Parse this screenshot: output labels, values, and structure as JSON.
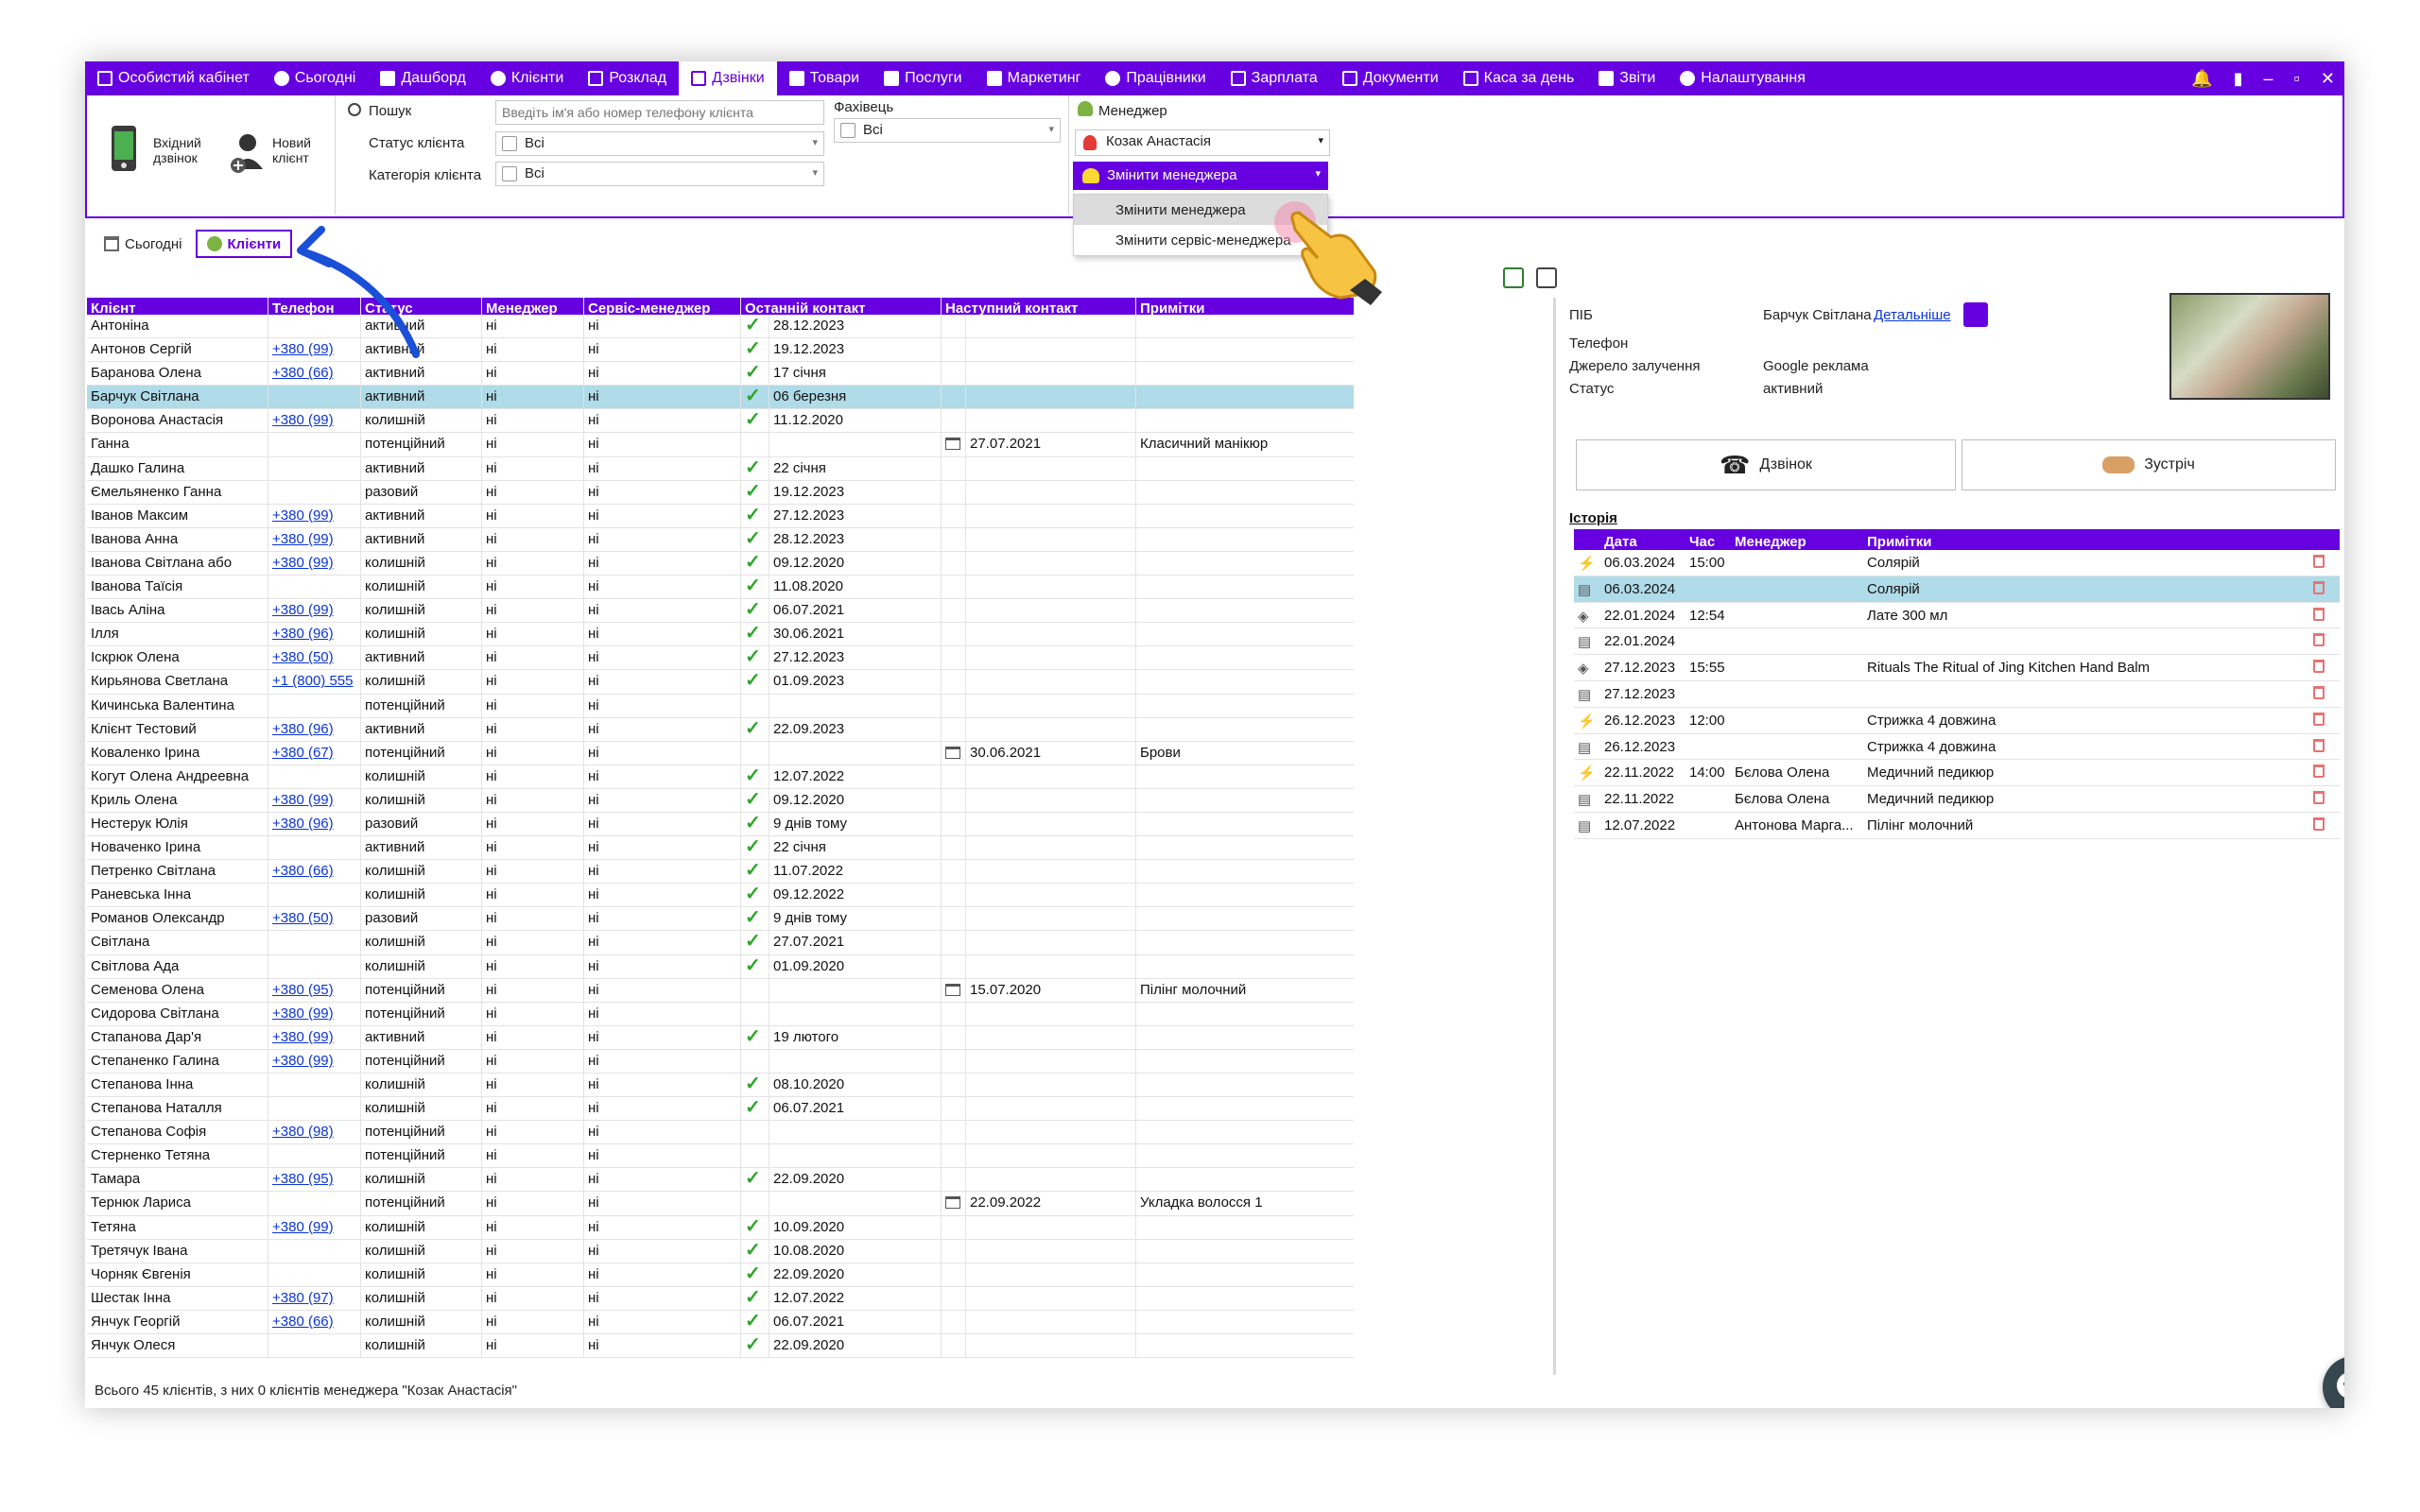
{
  "nav": {
    "items": [
      {
        "label": "Особистий кабінет",
        "icon": "cabinet-icon",
        "active": false
      },
      {
        "label": "Сьогодні",
        "icon": "today-icon",
        "active": false
      },
      {
        "label": "Дашборд",
        "icon": "dashboard-icon",
        "active": false
      },
      {
        "label": "Клієнти",
        "icon": "clients-icon",
        "active": false
      },
      {
        "label": "Розклад",
        "icon": "schedule-icon",
        "active": false
      },
      {
        "label": "Дзвінки",
        "icon": "calls-icon",
        "active": true
      },
      {
        "label": "Товари",
        "icon": "products-icon",
        "active": false
      },
      {
        "label": "Послуги",
        "icon": "services-icon",
        "active": false
      },
      {
        "label": "Маркетинг",
        "icon": "marketing-icon",
        "active": false
      },
      {
        "label": "Працівники",
        "icon": "employees-icon",
        "active": false
      },
      {
        "label": "Зарплата",
        "icon": "salary-icon",
        "active": false
      },
      {
        "label": "Документи",
        "icon": "documents-icon",
        "active": false
      },
      {
        "label": "Каса за день",
        "icon": "cash-icon",
        "active": false
      },
      {
        "label": "Звіти",
        "icon": "reports-icon",
        "active": false
      },
      {
        "label": "Налаштування",
        "icon": "settings-icon",
        "active": false
      }
    ]
  },
  "ribbon": {
    "incoming_call": "Вхідний дзвінок",
    "new_client": "Новий клієнт",
    "search_label": "Пошук",
    "search_placeholder": "Введіть ім'я або номер телефону клієнта",
    "status_label": "Статус клієнта",
    "status_value": "Всі",
    "category_label": "Категорія клієнта",
    "category_value": "Всі",
    "specialist_label": "Фахівець",
    "specialist_value": "Всі",
    "manager_label": "Менеджер",
    "manager_value": "Козак Анастасія",
    "change_manager_button": "Змінити менеджера",
    "menu_items": [
      "Змінити менеджера",
      "Змінити сервіс-менеджера"
    ]
  },
  "subtabs": [
    {
      "label": "Сьогодні",
      "active": false
    },
    {
      "label": "Клієнти",
      "active": true
    }
  ],
  "grid": {
    "columns": [
      "Клієнт",
      "Телефон",
      "Статус",
      "Менеджер",
      "Сервіс-менеджер",
      "Останній контакт",
      "Наступний контакт",
      "Примітки"
    ],
    "rows": [
      {
        "name": "Антоніна",
        "phone": "",
        "status": "активний",
        "mgr": "ні",
        "smgr": "ні",
        "check": true,
        "last": "28.12.2023",
        "cal": false,
        "next": "",
        "notes": ""
      },
      {
        "name": "Антонов Сергій",
        "phone": "+380 (99)",
        "status": "активний",
        "mgr": "ні",
        "smgr": "ні",
        "check": true,
        "last": "19.12.2023",
        "cal": false,
        "next": "",
        "notes": ""
      },
      {
        "name": "Баранова Олена",
        "phone": "+380 (66)",
        "status": "активний",
        "mgr": "ні",
        "smgr": "ні",
        "check": true,
        "last": "17 січня",
        "cal": false,
        "next": "",
        "notes": ""
      },
      {
        "name": "Барчук Світлана",
        "phone": "",
        "status": "активний",
        "mgr": "ні",
        "smgr": "ні",
        "check": true,
        "last": "06 березня",
        "cal": false,
        "next": "",
        "notes": "",
        "selected": true
      },
      {
        "name": "Воронова Анастасія",
        "phone": "+380 (99)",
        "status": "колишній",
        "mgr": "ні",
        "smgr": "ні",
        "check": true,
        "last": "11.12.2020",
        "cal": false,
        "next": "",
        "notes": ""
      },
      {
        "name": "Ганна",
        "phone": "",
        "status": "потенційний",
        "mgr": "ні",
        "smgr": "ні",
        "check": false,
        "last": "",
        "cal": true,
        "next": "27.07.2021",
        "notes": "Класичний манікюр"
      },
      {
        "name": "Дашко Галина",
        "phone": "",
        "status": "активний",
        "mgr": "ні",
        "smgr": "ні",
        "check": true,
        "last": "22 січня",
        "cal": false,
        "next": "",
        "notes": ""
      },
      {
        "name": "Ємельяненко Ганна",
        "phone": "",
        "status": "разовий",
        "mgr": "ні",
        "smgr": "ні",
        "check": true,
        "last": "19.12.2023",
        "cal": false,
        "next": "",
        "notes": ""
      },
      {
        "name": "Іванов Максим",
        "phone": "+380 (99)",
        "status": "активний",
        "mgr": "ні",
        "smgr": "ні",
        "check": true,
        "last": "27.12.2023",
        "cal": false,
        "next": "",
        "notes": ""
      },
      {
        "name": "Іванова Анна",
        "phone": "+380 (99)",
        "status": "активний",
        "mgr": "ні",
        "smgr": "ні",
        "check": true,
        "last": "28.12.2023",
        "cal": false,
        "next": "",
        "notes": ""
      },
      {
        "name": "Іванова Світлана або",
        "phone": "+380 (99)",
        "status": "колишній",
        "mgr": "ні",
        "smgr": "ні",
        "check": true,
        "last": "09.12.2020",
        "cal": false,
        "next": "",
        "notes": ""
      },
      {
        "name": "Іванова Таїсія",
        "phone": "",
        "status": "колишній",
        "mgr": "ні",
        "smgr": "ні",
        "check": true,
        "last": "11.08.2020",
        "cal": false,
        "next": "",
        "notes": ""
      },
      {
        "name": "Івась Аліна",
        "phone": "+380 (99)",
        "status": "колишній",
        "mgr": "ні",
        "smgr": "ні",
        "check": true,
        "last": "06.07.2021",
        "cal": false,
        "next": "",
        "notes": ""
      },
      {
        "name": "Ілля",
        "phone": "+380 (96)",
        "status": "колишній",
        "mgr": "ні",
        "smgr": "ні",
        "check": true,
        "last": "30.06.2021",
        "cal": false,
        "next": "",
        "notes": ""
      },
      {
        "name": "Іскрюк Олена",
        "phone": "+380 (50)",
        "status": "активний",
        "mgr": "ні",
        "smgr": "ні",
        "check": true,
        "last": "27.12.2023",
        "cal": false,
        "next": "",
        "notes": ""
      },
      {
        "name": "Кирьянова Светлана",
        "phone": "+1 (800) 555",
        "status": "колишній",
        "mgr": "ні",
        "smgr": "ні",
        "check": true,
        "last": "01.09.2023",
        "cal": false,
        "next": "",
        "notes": ""
      },
      {
        "name": "Кичинська Валентина",
        "phone": "",
        "status": "потенційний",
        "mgr": "ні",
        "smgr": "ні",
        "check": false,
        "last": "",
        "cal": false,
        "next": "",
        "notes": ""
      },
      {
        "name": "Клієнт Тестовий",
        "phone": "+380 (96)",
        "status": "активний",
        "mgr": "ні",
        "smgr": "ні",
        "check": true,
        "last": "22.09.2023",
        "cal": false,
        "next": "",
        "notes": ""
      },
      {
        "name": "Коваленко Ірина",
        "phone": "+380 (67)",
        "status": "потенційний",
        "mgr": "ні",
        "smgr": "ні",
        "check": false,
        "last": "",
        "cal": true,
        "next": "30.06.2021",
        "notes": "Брови"
      },
      {
        "name": "Когут Олена Андреевна",
        "phone": "",
        "status": "колишній",
        "mgr": "ні",
        "smgr": "ні",
        "check": true,
        "last": "12.07.2022",
        "cal": false,
        "next": "",
        "notes": ""
      },
      {
        "name": "Криль Олена",
        "phone": "+380 (99)",
        "status": "колишній",
        "mgr": "ні",
        "smgr": "ні",
        "check": true,
        "last": "09.12.2020",
        "cal": false,
        "next": "",
        "notes": ""
      },
      {
        "name": "Нестерук Юлія",
        "phone": "+380 (96)",
        "status": "разовий",
        "mgr": "ні",
        "smgr": "ні",
        "check": true,
        "last": "9 днів тому",
        "cal": false,
        "next": "",
        "notes": ""
      },
      {
        "name": "Новаченко Ірина",
        "phone": "",
        "status": "активний",
        "mgr": "ні",
        "smgr": "ні",
        "check": true,
        "last": "22 січня",
        "cal": false,
        "next": "",
        "notes": ""
      },
      {
        "name": "Петренко Світлана",
        "phone": "+380 (66)",
        "status": "колишній",
        "mgr": "ні",
        "smgr": "ні",
        "check": true,
        "last": "11.07.2022",
        "cal": false,
        "next": "",
        "notes": ""
      },
      {
        "name": "Раневська Інна",
        "phone": "",
        "status": "колишній",
        "mgr": "ні",
        "smgr": "ні",
        "check": true,
        "last": "09.12.2022",
        "cal": false,
        "next": "",
        "notes": ""
      },
      {
        "name": "Романов Олександр",
        "phone": "+380 (50)",
        "status": "разовий",
        "mgr": "ні",
        "smgr": "ні",
        "check": true,
        "last": "9 днів тому",
        "cal": false,
        "next": "",
        "notes": ""
      },
      {
        "name": "Світлана",
        "phone": "",
        "status": "колишній",
        "mgr": "ні",
        "smgr": "ні",
        "check": true,
        "last": "27.07.2021",
        "cal": false,
        "next": "",
        "notes": ""
      },
      {
        "name": "Світлова Ада",
        "phone": "",
        "status": "колишній",
        "mgr": "ні",
        "smgr": "ні",
        "check": true,
        "last": "01.09.2020",
        "cal": false,
        "next": "",
        "notes": ""
      },
      {
        "name": "Семенова Олена",
        "phone": "+380 (95)",
        "status": "потенційний",
        "mgr": "ні",
        "smgr": "ні",
        "check": false,
        "last": "",
        "cal": true,
        "next": "15.07.2020",
        "notes": "Пілінг молочний"
      },
      {
        "name": "Сидорова Світлана",
        "phone": "+380 (99)",
        "status": "потенційний",
        "mgr": "ні",
        "smgr": "ні",
        "check": false,
        "last": "",
        "cal": false,
        "next": "",
        "notes": ""
      },
      {
        "name": "Стапанова Дар'я",
        "phone": "+380 (99)",
        "status": "активний",
        "mgr": "ні",
        "smgr": "ні",
        "check": true,
        "last": "19 лютого",
        "cal": false,
        "next": "",
        "notes": ""
      },
      {
        "name": "Степаненко Галина",
        "phone": "+380 (99)",
        "status": "потенційний",
        "mgr": "ні",
        "smgr": "ні",
        "check": false,
        "last": "",
        "cal": false,
        "next": "",
        "notes": ""
      },
      {
        "name": "Степанова Інна",
        "phone": "",
        "status": "колишній",
        "mgr": "ні",
        "smgr": "ні",
        "check": true,
        "last": "08.10.2020",
        "cal": false,
        "next": "",
        "notes": ""
      },
      {
        "name": "Степанова Наталля",
        "phone": "",
        "status": "колишній",
        "mgr": "ні",
        "smgr": "ні",
        "check": true,
        "last": "06.07.2021",
        "cal": false,
        "next": "",
        "notes": ""
      },
      {
        "name": "Степанова Софія",
        "phone": "+380 (98)",
        "status": "потенційний",
        "mgr": "ні",
        "smgr": "ні",
        "check": false,
        "last": "",
        "cal": false,
        "next": "",
        "notes": ""
      },
      {
        "name": "Стерненко Тетяна",
        "phone": "",
        "status": "потенційний",
        "mgr": "ні",
        "smgr": "ні",
        "check": false,
        "last": "",
        "cal": false,
        "next": "",
        "notes": ""
      },
      {
        "name": "Тамара",
        "phone": "+380 (95)",
        "status": "колишній",
        "mgr": "ні",
        "smgr": "ні",
        "check": true,
        "last": "22.09.2020",
        "cal": false,
        "next": "",
        "notes": ""
      },
      {
        "name": "Тернюк Лариса",
        "phone": "",
        "status": "потенційний",
        "mgr": "ні",
        "smgr": "ні",
        "check": false,
        "last": "",
        "cal": true,
        "next": "22.09.2022",
        "notes": "Укладка волосся 1"
      },
      {
        "name": "Тетяна",
        "phone": "+380 (99)",
        "status": "колишній",
        "mgr": "ні",
        "smgr": "ні",
        "check": true,
        "last": "10.09.2020",
        "cal": false,
        "next": "",
        "notes": ""
      },
      {
        "name": "Третячук Івана",
        "phone": "",
        "status": "колишній",
        "mgr": "ні",
        "smgr": "ні",
        "check": true,
        "last": "10.08.2020",
        "cal": false,
        "next": "",
        "notes": ""
      },
      {
        "name": "Чорняк Євгенія",
        "phone": "",
        "status": "колишній",
        "mgr": "ні",
        "smgr": "ні",
        "check": true,
        "last": "22.09.2020",
        "cal": false,
        "next": "",
        "notes": ""
      },
      {
        "name": "Шестак Інна",
        "phone": "+380 (97)",
        "status": "колишній",
        "mgr": "ні",
        "smgr": "ні",
        "check": true,
        "last": "12.07.2022",
        "cal": false,
        "next": "",
        "notes": ""
      },
      {
        "name": "Янчук Георгій",
        "phone": "+380 (66)",
        "status": "колишній",
        "mgr": "ні",
        "smgr": "ні",
        "check": true,
        "last": "06.07.2021",
        "cal": false,
        "next": "",
        "notes": ""
      },
      {
        "name": "Янчук Олеся",
        "phone": "",
        "status": "колишній",
        "mgr": "ні",
        "smgr": "ні",
        "check": true,
        "last": "22.09.2020",
        "cal": false,
        "next": "",
        "notes": ""
      }
    ]
  },
  "footer": {
    "text": "Всього 45 клієнтів, з них 0 клієнтів менеджера \"Козак Анастасія\""
  },
  "details": {
    "pib_label": "ПІБ",
    "pib_value": "Барчук Світлана",
    "details_link": "Детальніше",
    "phone_label": "Телефон",
    "source_label": "Джерело залучення",
    "source_value": "Google реклама",
    "status_label": "Статус",
    "status_value": "активний",
    "call_button": "Дзвінок",
    "meeting_button": "Зустріч",
    "history_title": "Історія"
  },
  "history": {
    "columns": [
      "Дата",
      "Час",
      "Менеджер",
      "Примітки"
    ],
    "rows": [
      {
        "icon": "lightning-icon",
        "date": "06.03.2024",
        "time": "15:00",
        "mgr": "",
        "notes": "Солярій"
      },
      {
        "icon": "calendar-icon",
        "date": "06.03.2024",
        "time": "",
        "mgr": "",
        "notes": "Солярій",
        "selected": true
      },
      {
        "icon": "box-icon",
        "date": "22.01.2024",
        "time": "12:54",
        "mgr": "",
        "notes": "Лате 300 мл"
      },
      {
        "icon": "calendar-icon",
        "date": "22.01.2024",
        "time": "",
        "mgr": "",
        "notes": ""
      },
      {
        "icon": "box-icon",
        "date": "27.12.2023",
        "time": "15:55",
        "mgr": "",
        "notes": "Rituals The Ritual of Jing Kitchen Hand Balm"
      },
      {
        "icon": "calendar-icon",
        "date": "27.12.2023",
        "time": "",
        "mgr": "",
        "notes": ""
      },
      {
        "icon": "lightning-icon",
        "date": "26.12.2023",
        "time": "12:00",
        "mgr": "",
        "notes": "Стрижка 4 довжина"
      },
      {
        "icon": "calendar-icon",
        "date": "26.12.2023",
        "time": "",
        "mgr": "",
        "notes": "Стрижка 4 довжина"
      },
      {
        "icon": "lightning-icon",
        "date": "22.11.2022",
        "time": "14:00",
        "mgr": "Бєлова Олена",
        "notes": "Медичний педикюр"
      },
      {
        "icon": "calendar-icon",
        "date": "22.11.2022",
        "time": "",
        "mgr": "Бєлова Олена",
        "notes": "Медичний педикюр"
      },
      {
        "icon": "calendar-icon",
        "date": "12.07.2022",
        "time": "",
        "mgr": "Антонова Марга...",
        "notes": "Пілінг молочний"
      }
    ]
  },
  "colors": {
    "brand": "#6600e0",
    "selected_row": "#b0dbe8",
    "link": "#0b34d6",
    "check": "#2fa52c",
    "annotation_arrow": "#1a4fd8"
  }
}
